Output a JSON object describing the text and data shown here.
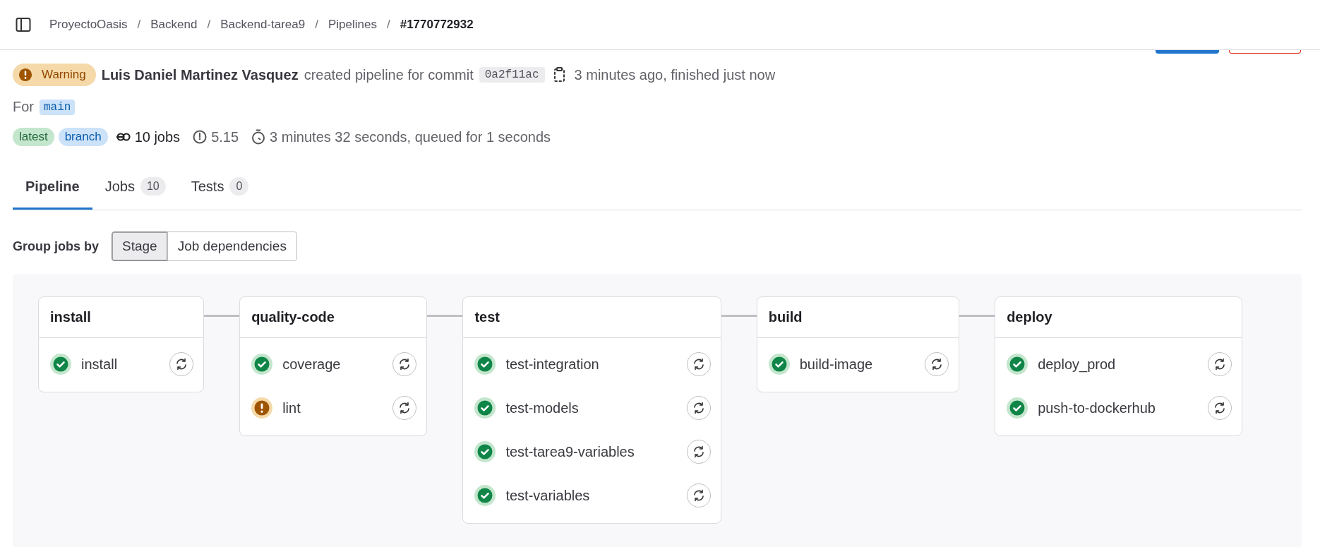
{
  "breadcrumbs": [
    {
      "label": "ProyectoOasis",
      "current": false
    },
    {
      "separator": "/",
      "label": "Backend",
      "current": false
    },
    {
      "separator": "/",
      "label": "Backend-tarea9",
      "current": false
    },
    {
      "separator": "/",
      "label": "Pipelines",
      "current": false
    },
    {
      "separator": "/",
      "label": "#1770772932",
      "current": true
    }
  ],
  "header": {
    "status": {
      "kind": "warning",
      "label": "Warning"
    },
    "author": "Luis Daniel Martinez Vasquez",
    "action": "created pipeline for commit",
    "commit": "0a2f11ac",
    "time": "3 minutes ago, finished just now"
  },
  "ref": {
    "prefix": "For",
    "branch": "main"
  },
  "badges": [
    {
      "label": "latest",
      "kind": "success"
    },
    {
      "label": "branch",
      "kind": "info"
    }
  ],
  "meta": {
    "jobs": "10 jobs",
    "version": "5.15",
    "duration": "3 minutes 32 seconds, queued for 1 seconds"
  },
  "tabs": [
    {
      "label": "Pipeline",
      "selected": true
    },
    {
      "label": "Jobs",
      "count": "10",
      "selected": false
    },
    {
      "label": "Tests",
      "count": "0",
      "selected": false
    }
  ],
  "group_by": {
    "label": "Group jobs by",
    "options": [
      {
        "label": "Stage",
        "selected": true
      },
      {
        "label": "Job dependencies",
        "selected": false
      }
    ]
  },
  "stages": [
    {
      "name": "install",
      "jobs": [
        {
          "name": "install",
          "kind": "success"
        }
      ]
    },
    {
      "name": "quality-code",
      "jobs": [
        {
          "name": "coverage",
          "kind": "success"
        },
        {
          "name": "lint",
          "kind": "warning"
        }
      ]
    },
    {
      "name": "test",
      "jobs": [
        {
          "name": "test-integration",
          "kind": "success"
        },
        {
          "name": "test-models",
          "kind": "success"
        },
        {
          "name": "test-tarea9-variables",
          "kind": "success"
        },
        {
          "name": "test-variables",
          "kind": "success"
        }
      ]
    },
    {
      "name": "build",
      "jobs": [
        {
          "name": "build-image",
          "kind": "success"
        }
      ]
    },
    {
      "name": "deploy",
      "jobs": [
        {
          "name": "deploy_prod",
          "kind": "success"
        },
        {
          "name": "push-to-dockerhub",
          "kind": "success"
        }
      ]
    }
  ]
}
